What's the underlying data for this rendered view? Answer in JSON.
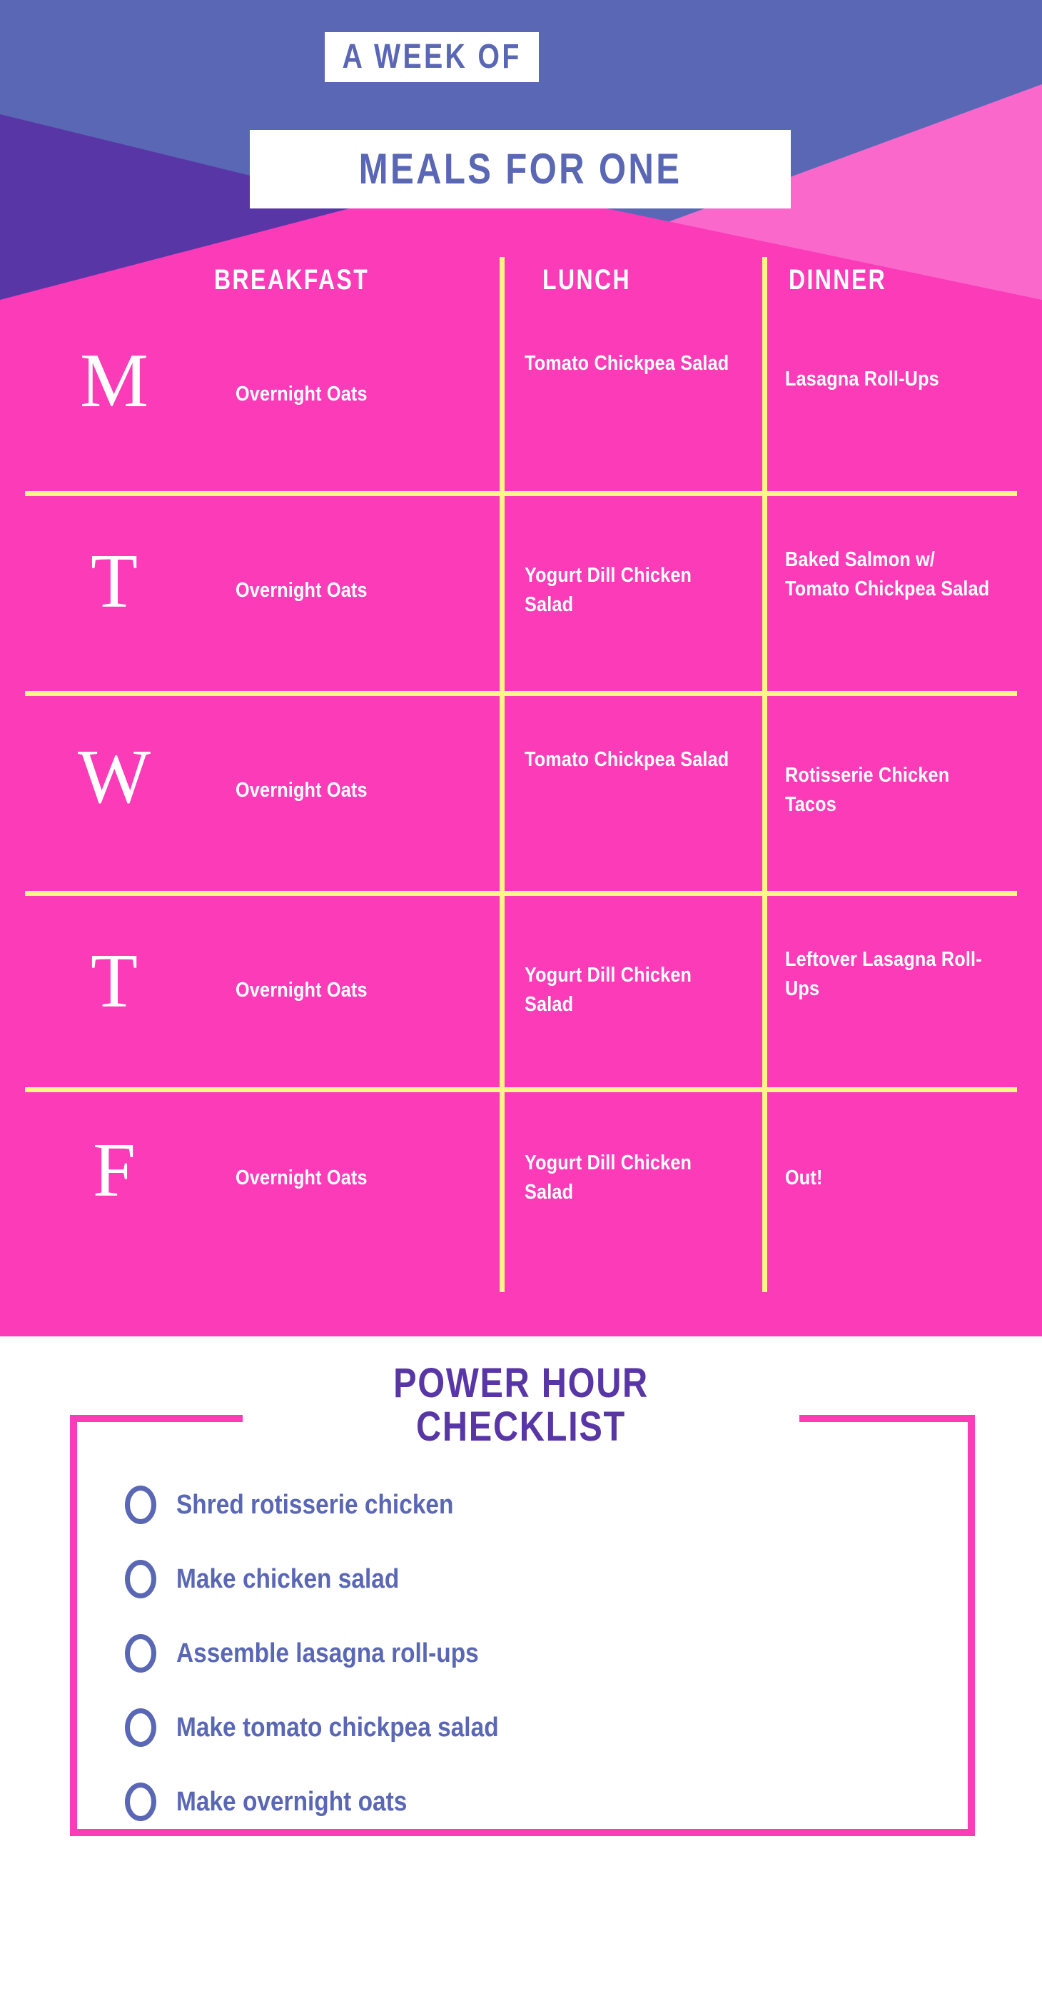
{
  "colors": {
    "periwinkle": "#5A67B5",
    "dark_purple": "#5936A5",
    "magenta": "#FB3BB8",
    "light_pink": "#FB68CC",
    "yellow": "#FFF588",
    "white": "#FFFFFF"
  },
  "header": {
    "title_line_1": "A WEEK OF",
    "title_line_2": "MEALS FOR ONE"
  },
  "meal_table": {
    "columns": [
      "BREAKFAST",
      "LUNCH",
      "DINNER"
    ],
    "rows": [
      {
        "day_letter": "M",
        "breakfast": "Overnight Oats",
        "lunch": "Tomato Chickpea Salad",
        "dinner": "Lasagna Roll-Ups"
      },
      {
        "day_letter": "T",
        "breakfast": "Overnight Oats",
        "lunch": "Yogurt Dill Chicken Salad",
        "dinner": "Baked Salmon w/ Tomato Chickpea Salad"
      },
      {
        "day_letter": "W",
        "breakfast": "Overnight Oats",
        "lunch": "Tomato Chickpea Salad",
        "dinner": "Rotisserie Chicken Tacos"
      },
      {
        "day_letter": "T",
        "breakfast": "Overnight Oats",
        "lunch": "Yogurt Dill Chicken Salad",
        "dinner": "Leftover Lasagna Roll-Ups"
      },
      {
        "day_letter": "F",
        "breakfast": "Overnight Oats",
        "lunch": "Yogurt Dill Chicken Salad",
        "dinner": "Out!"
      }
    ]
  },
  "checklist": {
    "title_line_1": "POWER HOUR",
    "title_line_2": "CHECKLIST",
    "items": [
      "Shred rotisserie chicken",
      "Make chicken salad",
      "Assemble lasagna roll-ups",
      "Make tomato chickpea salad",
      "Make overnight oats"
    ]
  }
}
